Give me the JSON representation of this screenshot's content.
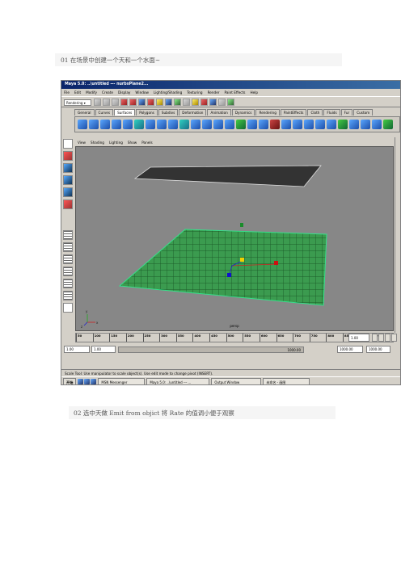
{
  "captions": {
    "step1": "01 在场景中创建一个天和一个水面~",
    "step2": "02 选中天做 Emit from objict  将 Rate 的值调小便于观察"
  },
  "window": {
    "title": "Maya 5.0: ..\\untitled  ---  nurbsPlane2..."
  },
  "menu": [
    "File",
    "Edit",
    "Modify",
    "Create",
    "Display",
    "Window",
    "Lighting/Shading",
    "Texturing",
    "Render",
    "Paint Effects",
    "Help"
  ],
  "status_line": {
    "mode": "Rendering"
  },
  "shelf": {
    "tabs": [
      "General",
      "Curves",
      "Surfaces",
      "Polygons",
      "Subdivs",
      "Deformation",
      "Animation",
      "Dynamics",
      "Rendering",
      "PaintEffects",
      "Cloth",
      "Fluids",
      "Fur",
      "Custom"
    ],
    "active_tab": "Surfaces"
  },
  "panel_menu": [
    "View",
    "Shading",
    "Lighting",
    "Show",
    "Panels"
  ],
  "viewport": {
    "camera_label": "persp",
    "axis_labels": [
      "x",
      "y",
      "z"
    ]
  },
  "time_slider": {
    "ticks": [
      "50",
      "100",
      "150",
      "200",
      "250",
      "300",
      "350",
      "400",
      "450",
      "500",
      "550",
      "600",
      "650",
      "700",
      "750",
      "800",
      "850",
      "900",
      "950"
    ],
    "current_time": "1.00"
  },
  "range_slider": {
    "start_time": "1.00",
    "playback_start": "1.00",
    "range_label": "1000.00",
    "playback_end": "1000.00",
    "end_time": "1000.00"
  },
  "help_line": "Scale Tool: Use manipulator to scale object(s). Use edit mode to change pivot (INSERT).",
  "taskbar": {
    "start": "开始",
    "buttons": [
      "MSN Messenger",
      "Maya 5.0: ..\\untitled  --- ...",
      "Output Window",
      "未命名 - 画图"
    ]
  }
}
